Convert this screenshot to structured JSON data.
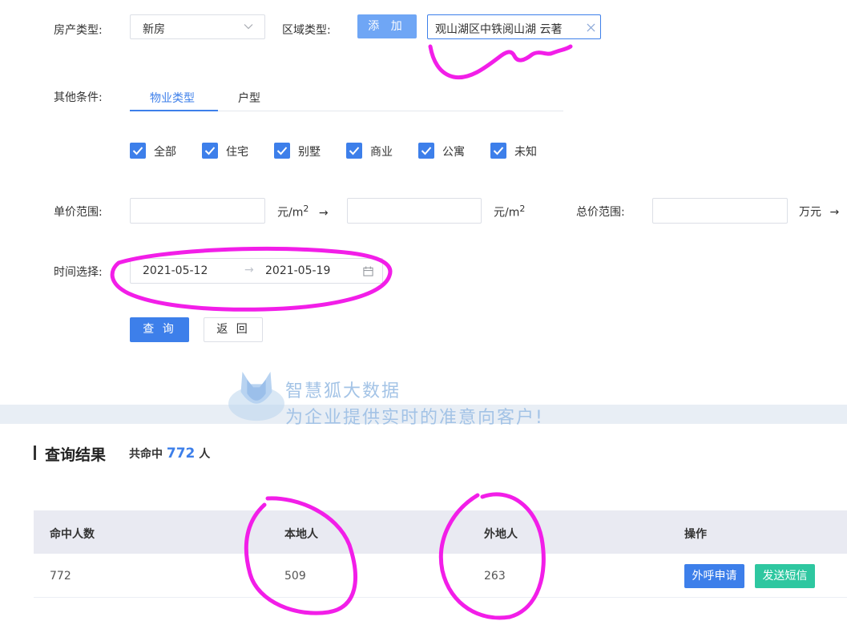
{
  "filters": {
    "property_type_label": "房产类型:",
    "property_type_value": "新房",
    "area_type_label": "区域类型:",
    "add_button": "添 加",
    "area_tag": "观山湖区中铁阅山湖 云著",
    "other_label": "其他条件:",
    "tabs": [
      "物业类型",
      "户型"
    ],
    "checkboxes": [
      "全部",
      "住宅",
      "别墅",
      "商业",
      "公寓",
      "未知"
    ],
    "price_label": "单价范围:",
    "price_unit": "元/m",
    "price_unit_sup": "2",
    "arrow": "→",
    "total_label": "总价范围:",
    "total_unit": "万元",
    "time_label": "时间选择:",
    "date_start": "2021-05-12",
    "date_end": "2021-05-19",
    "query_button": "查 询",
    "back_button": "返 回"
  },
  "watermark": {
    "line1": "智慧狐大数据",
    "line2": "为企业提供实时的准意向客户!"
  },
  "results": {
    "title": "查询结果",
    "hit_prefix": "共命中",
    "hit_count": "772",
    "hit_suffix": "人",
    "columns": [
      "命中人数",
      "本地人",
      "外地人",
      "操作"
    ],
    "row": [
      "772",
      "509",
      "263"
    ],
    "call_button": "外呼申请",
    "sms_button": "发送短信"
  },
  "colors": {
    "accent": "#3d7fea",
    "green": "#2ec7a0",
    "annotation": "#f21ee8"
  }
}
